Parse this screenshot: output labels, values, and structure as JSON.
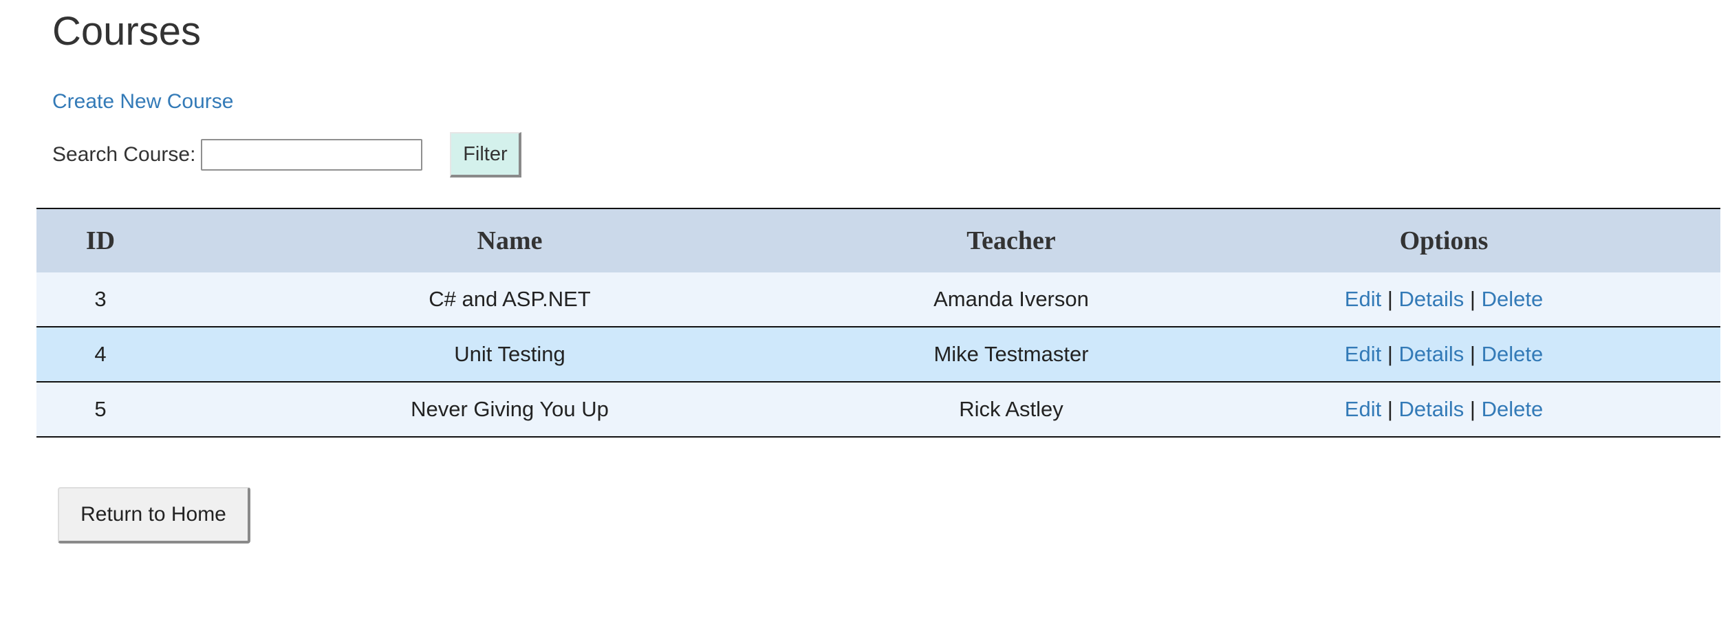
{
  "page": {
    "title": "Courses",
    "create_link_label": "Create New Course"
  },
  "search": {
    "label": "Search Course:",
    "value": "",
    "placeholder": "",
    "filter_button_label": "Filter"
  },
  "table": {
    "headers": {
      "id": "ID",
      "name": "Name",
      "teacher": "Teacher",
      "options": "Options"
    },
    "option_labels": {
      "edit": "Edit",
      "details": "Details",
      "delete": "Delete",
      "separator": "|"
    },
    "rows": [
      {
        "id": "3",
        "name": "C# and ASP.NET",
        "teacher": "Amanda Iverson"
      },
      {
        "id": "4",
        "name": "Unit Testing",
        "teacher": "Mike Testmaster"
      },
      {
        "id": "5",
        "name": "Never Giving You Up",
        "teacher": "Rick Astley"
      }
    ]
  },
  "footer": {
    "return_button_label": "Return to Home"
  },
  "colors": {
    "link": "#337ab7",
    "header_bg": "#cbd9ea",
    "row_odd_bg": "#edf4fc",
    "row_even_bg": "#cfe8fb",
    "filter_button_bg": "#d4f1ec"
  }
}
